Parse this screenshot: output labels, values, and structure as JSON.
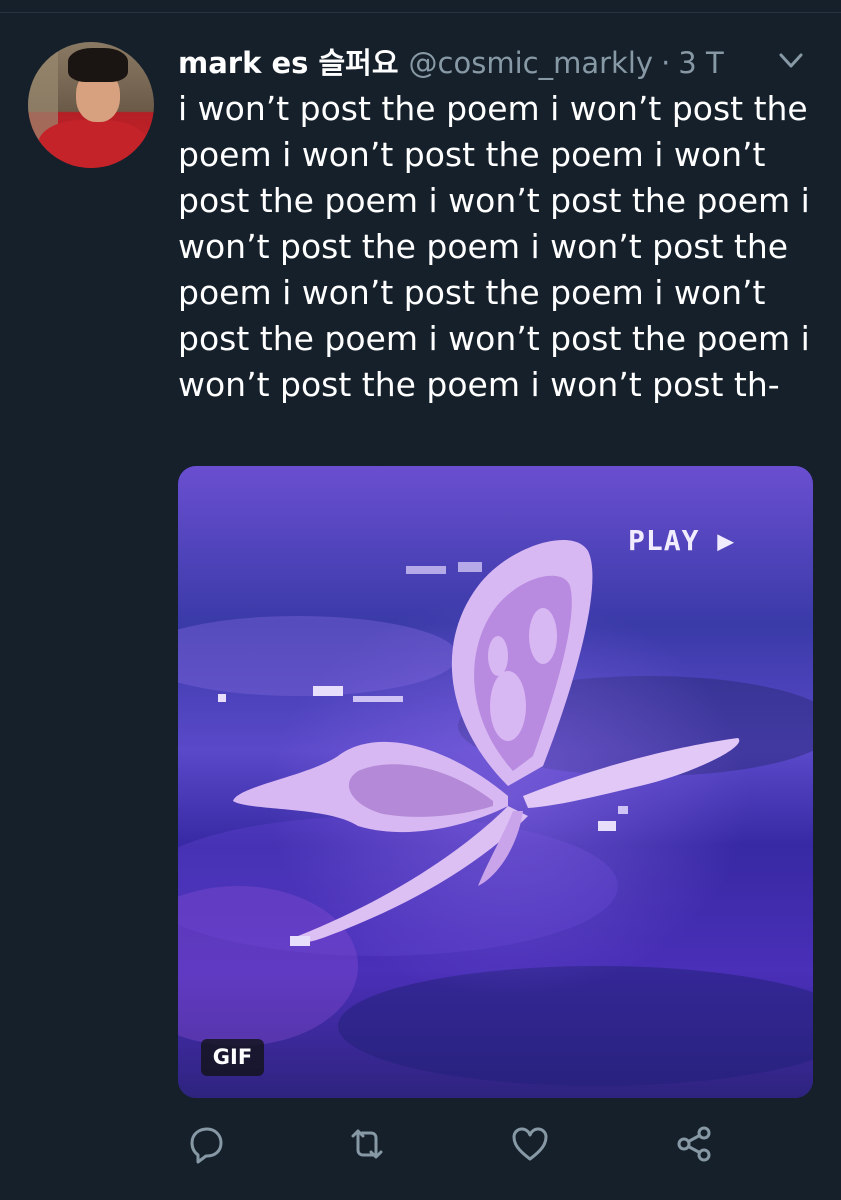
{
  "tweet": {
    "display_name": "mark es 슬퍼요",
    "handle": "@cosmic_markly",
    "separator": "·",
    "time": "3 T",
    "text": "i won’t post the poem i won’t post the poem i won’t post the poem i won’t post the poem i won’t post the poem i won’t post the poem i won’t post the poem i won’t post the poem i won’t post the poem i won’t post the poem i won’t post the poem i won’t post th-"
  },
  "media": {
    "overlay_text": "PLAY",
    "play_glyph": "▶",
    "badge": "GIF"
  },
  "icons": {
    "caret": "chevron-down-icon",
    "reply": "reply-icon",
    "retweet": "retweet-icon",
    "like": "heart-icon",
    "share": "share-icon"
  },
  "colors": {
    "background": "#15202b",
    "secondary_text": "#8899a6",
    "icon": "#8899a6"
  }
}
